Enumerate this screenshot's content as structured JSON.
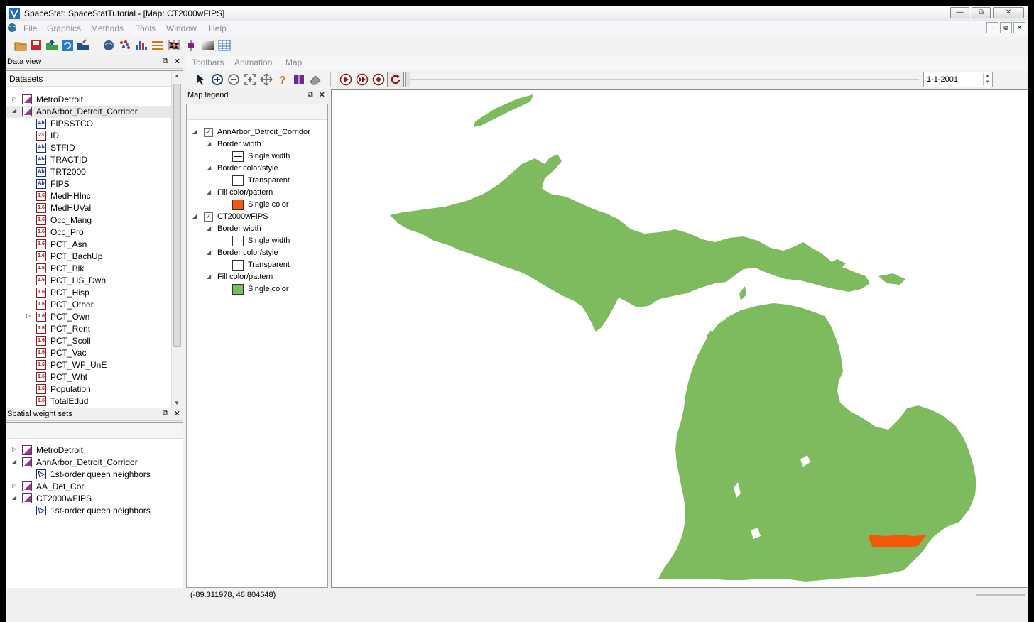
{
  "window": {
    "title": "SpaceStat: SpaceStatTutorial - [Map: CT2000wFIPS]"
  },
  "menu": [
    "File",
    "Graphics",
    "Methods",
    "Tools",
    "Window",
    "Help"
  ],
  "map_menu": [
    "Toolbars",
    "Animation",
    "Map"
  ],
  "toolbar_icons": [
    "open-folder-icon",
    "save-icon",
    "export-icon",
    "refresh-icon",
    "import-icon",
    "globe-icon",
    "scatter-icon",
    "histogram-icon",
    "lines-icon",
    "parallel-plot-icon",
    "boxplot-icon",
    "gradient-icon",
    "table-icon"
  ],
  "map_tools": [
    "select-arrow-icon",
    "zoom-in-icon",
    "zoom-out-icon",
    "zoom-extent-icon",
    "pan-icon",
    "help-icon",
    "book-icon",
    "eraser-icon"
  ],
  "animation": {
    "date": "1-1-2001",
    "controls": [
      "play-icon",
      "fast-forward-icon",
      "stop-icon",
      "loop-icon"
    ]
  },
  "data_view": {
    "title": "Data view",
    "header": "Datasets",
    "datasets": [
      {
        "name": "MetroDetroit",
        "expanded": false
      },
      {
        "name": "AnnArbor_Detroit_Corridor",
        "expanded": true
      }
    ],
    "variables": [
      {
        "name": "FIPSSTCO",
        "type": "str"
      },
      {
        "name": "ID",
        "type": "int"
      },
      {
        "name": "STFID",
        "type": "str"
      },
      {
        "name": "TRACTID",
        "type": "str"
      },
      {
        "name": "TRT2000",
        "type": "str"
      },
      {
        "name": "FIPS",
        "type": "str"
      },
      {
        "name": "MedHHInc",
        "type": "num"
      },
      {
        "name": "MedHUVal",
        "type": "num"
      },
      {
        "name": "Occ_Mang",
        "type": "num"
      },
      {
        "name": "Occ_Pro",
        "type": "num"
      },
      {
        "name": "PCT_Asn",
        "type": "num"
      },
      {
        "name": "PCT_BachUp",
        "type": "num"
      },
      {
        "name": "PCT_Blk",
        "type": "num"
      },
      {
        "name": "PCT_HS_Dwn",
        "type": "num"
      },
      {
        "name": "PCT_Hisp",
        "type": "num"
      },
      {
        "name": "PCT_Other",
        "type": "num"
      },
      {
        "name": "PCT_Own",
        "type": "num"
      },
      {
        "name": "PCT_Rent",
        "type": "num"
      },
      {
        "name": "PCT_Scoll",
        "type": "num"
      },
      {
        "name": "PCT_Vac",
        "type": "num"
      },
      {
        "name": "PCT_WF_UnE",
        "type": "num"
      },
      {
        "name": "PCT_Wht",
        "type": "num"
      },
      {
        "name": "Population",
        "type": "num"
      },
      {
        "name": "TotalEdud",
        "type": "num"
      }
    ]
  },
  "spatial_weights": {
    "title": "Spatial weight sets",
    "items": [
      {
        "name": "MetroDetroit",
        "level": 0,
        "kind": "dataset",
        "expander": "collapsed"
      },
      {
        "name": "AnnArbor_Detroit_Corridor",
        "level": 0,
        "kind": "dataset",
        "expander": "expanded"
      },
      {
        "name": "1st-order queen neighbors",
        "level": 1,
        "kind": "weight",
        "expander": ""
      },
      {
        "name": "AA_Det_Cor",
        "level": 0,
        "kind": "dataset",
        "expander": "collapsed"
      },
      {
        "name": "CT2000wFIPS",
        "level": 0,
        "kind": "dataset",
        "expander": "expanded"
      },
      {
        "name": "1st-order queen neighbors",
        "level": 1,
        "kind": "weight",
        "expander": ""
      }
    ]
  },
  "legend": {
    "title": "Map legend",
    "layers": [
      {
        "name": "AnnArbor_Detroit_Corridor",
        "checked": true,
        "props": [
          {
            "label": "Border width",
            "value": "Single width",
            "swatch": "#ffffff",
            "swatch_kind": "line"
          },
          {
            "label": "Border color/style",
            "value": "Transparent",
            "swatch": "#ffffff",
            "swatch_kind": "empty"
          },
          {
            "label": "Fill color/pattern",
            "value": "Single color",
            "swatch": "#f25a0a",
            "swatch_kind": "fill"
          }
        ]
      },
      {
        "name": "CT2000wFIPS",
        "checked": true,
        "props": [
          {
            "label": "Border width",
            "value": "Single width",
            "swatch": "#ffffff",
            "swatch_kind": "line"
          },
          {
            "label": "Border color/style",
            "value": "Transparent",
            "swatch": "#ffffff",
            "swatch_kind": "empty"
          },
          {
            "label": "Fill color/pattern",
            "value": "Single color",
            "swatch": "#7dbb5e",
            "swatch_kind": "fill"
          }
        ]
      }
    ]
  },
  "map": {
    "land_color": "#7dbb5e",
    "corridor_color": "#f25a0a"
  },
  "status": {
    "coords": "(-89.311978, 46.804648)"
  }
}
